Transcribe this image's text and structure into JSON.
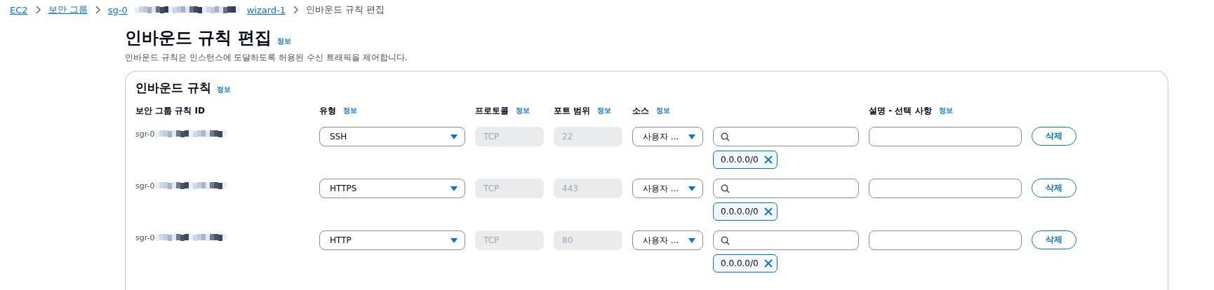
{
  "breadcrumbs": [
    {
      "kind": "link",
      "label": "EC2"
    },
    {
      "kind": "link",
      "label": "보안 그룹"
    },
    {
      "kind": "redacted_link",
      "label": "sg-0",
      "suffix": "wizard-1"
    },
    {
      "kind": "current",
      "label": "인바운드 규칙 편집"
    }
  ],
  "page": {
    "title": "인바운드 규칙 편집",
    "info": "정보",
    "description": "인바운드 규칙은 인스턴스에 도달하도록 허용된 수신 트래픽을 제어합니다."
  },
  "panel": {
    "title": "인바운드 규칙",
    "info": "정보",
    "columns": [
      {
        "label": "보안 그룹 규칙 ID"
      },
      {
        "label": "유형",
        "info": "정보"
      },
      {
        "label": "프로토콜",
        "info": "정보"
      },
      {
        "label": "포트 범위",
        "info": "정보"
      },
      {
        "label": "소스",
        "info": "정보"
      },
      {
        "label": "설명 - 선택 사항",
        "info": "정보"
      }
    ],
    "rules": [
      {
        "id": "sgr-0",
        "type": "SSH",
        "protocol": "TCP",
        "port": "22",
        "source": "사용자 ...",
        "token": "0.0.0.0/0",
        "delete": "삭제"
      },
      {
        "id": "sgr-0",
        "type": "HTTPS",
        "protocol": "TCP",
        "port": "443",
        "source": "사용자 ...",
        "token": "0.0.0.0/0",
        "delete": "삭제"
      },
      {
        "id": "sgr-0",
        "type": "HTTP",
        "protocol": "TCP",
        "port": "80",
        "source": "사용자 ...",
        "token": "0.0.0.0/0",
        "delete": "삭제"
      }
    ]
  }
}
